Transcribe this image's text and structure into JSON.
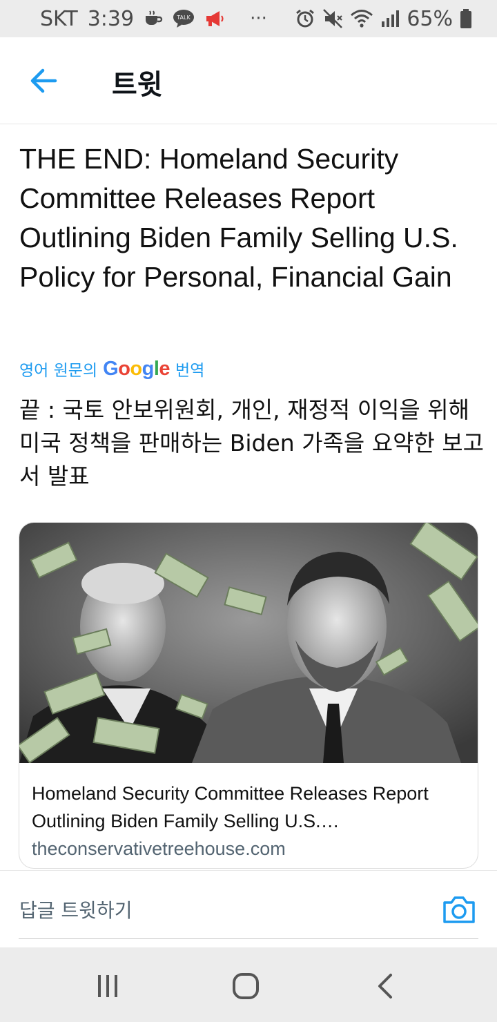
{
  "status_bar": {
    "carrier": "SKT",
    "time": "3:39",
    "talk_badge": "TALK",
    "more": "···",
    "battery_percent": "65%",
    "icons": [
      "coffee-icon",
      "talk-icon",
      "megaphone-icon",
      "alarm-icon",
      "mute-icon",
      "wifi-icon",
      "signal-icon",
      "battery-icon"
    ],
    "alert_color": "#e53935"
  },
  "header": {
    "title": "트윗"
  },
  "tweet": {
    "text": "THE END: Homeland Security Committee Releases Report Outlining Biden Family Selling U.S. Policy for Personal, Financial Gain",
    "translate_prefix": "영어 원문의",
    "translate_brand": [
      "G",
      "o",
      "o",
      "g",
      "l",
      "e"
    ],
    "translate_suffix": "번역",
    "translated_text": "끝 : 국토 안보위원회, 개인, 재정적 이익을 위해 미국 정책을 판매하는 Biden 가족을 요약한 보고서 발표"
  },
  "card": {
    "title": "Homeland Security Committee Releases Report Outlining Biden Family Selling U.S.…",
    "domain": "theconservativetreehouse.com",
    "image_alt": "Black-and-white photo of two men in suits with dollar bills flying"
  },
  "reply": {
    "placeholder": "답글 트윗하기"
  },
  "colors": {
    "accent": "#1d9bf0",
    "text": "#111111",
    "muted": "#536471",
    "google": [
      "#4285f4",
      "#ea4335",
      "#fbbc05",
      "#4285f4",
      "#34a853",
      "#ea4335"
    ]
  },
  "nav": {
    "icons": [
      "recent-apps-icon",
      "home-icon",
      "back-nav-icon"
    ]
  }
}
